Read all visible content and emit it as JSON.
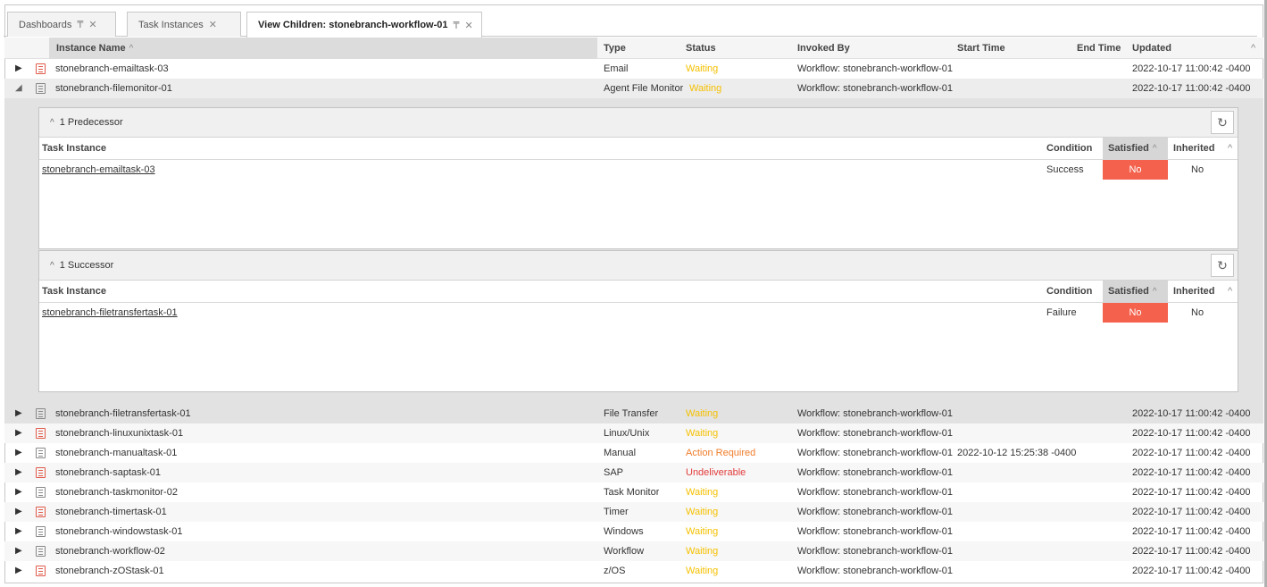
{
  "tabs": [
    {
      "label": "Dashboards",
      "pinned": true,
      "active": false
    },
    {
      "label": "Task Instances",
      "pinned": false,
      "active": false
    },
    {
      "label": "View Children: stonebranch-workflow-01",
      "pinned": true,
      "active": true
    }
  ],
  "grid": {
    "headers": {
      "name": "Instance Name",
      "type": "Type",
      "status": "Status",
      "invoked_by": "Invoked By",
      "start_time": "Start Time",
      "end_time": "End Time",
      "updated": "Updated"
    },
    "rows": [
      {
        "name": "stonebranch-emailtask-03",
        "type": "Email",
        "status": "Waiting",
        "invoked_by": "Workflow: stonebranch-workflow-01",
        "start_time": "",
        "end_time": "",
        "updated": "2022-10-17 11:00:42 -0400",
        "icon": "task-red"
      },
      {
        "name": "stonebranch-filemonitor-01",
        "type": "Agent File Monitor",
        "status": "Waiting",
        "invoked_by": "Workflow: stonebranch-workflow-01",
        "start_time": "",
        "end_time": "",
        "updated": "2022-10-17 11:00:42 -0400",
        "icon": "task-gray",
        "expanded": true
      },
      {
        "name": "stonebranch-filetransfertask-01",
        "type": "File Transfer",
        "status": "Waiting",
        "invoked_by": "Workflow: stonebranch-workflow-01",
        "start_time": "",
        "end_time": "",
        "updated": "2022-10-17 11:00:42 -0400",
        "icon": "task-gray"
      },
      {
        "name": "stonebranch-linuxunixtask-01",
        "type": "Linux/Unix",
        "status": "Waiting",
        "invoked_by": "Workflow: stonebranch-workflow-01",
        "start_time": "",
        "end_time": "",
        "updated": "2022-10-17 11:00:42 -0400",
        "icon": "task-red"
      },
      {
        "name": "stonebranch-manualtask-01",
        "type": "Manual",
        "status": "Action Required",
        "invoked_by": "Workflow: stonebranch-workflow-01",
        "start_time": "2022-10-12 15:25:38 -0400",
        "end_time": "",
        "updated": "2022-10-17 11:00:42 -0400",
        "icon": "task-gray"
      },
      {
        "name": "stonebranch-saptask-01",
        "type": "SAP",
        "status": "Undeliverable",
        "invoked_by": "Workflow: stonebranch-workflow-01",
        "start_time": "",
        "end_time": "",
        "updated": "2022-10-17 11:00:42 -0400",
        "icon": "task-red"
      },
      {
        "name": "stonebranch-taskmonitor-02",
        "type": "Task Monitor",
        "status": "Waiting",
        "invoked_by": "Workflow: stonebranch-workflow-01",
        "start_time": "",
        "end_time": "",
        "updated": "2022-10-17 11:00:42 -0400",
        "icon": "task-gray"
      },
      {
        "name": "stonebranch-timertask-01",
        "type": "Timer",
        "status": "Waiting",
        "invoked_by": "Workflow: stonebranch-workflow-01",
        "start_time": "",
        "end_time": "",
        "updated": "2022-10-17 11:00:42 -0400",
        "icon": "task-red"
      },
      {
        "name": "stonebranch-windowstask-01",
        "type": "Windows",
        "status": "Waiting",
        "invoked_by": "Workflow: stonebranch-workflow-01",
        "start_time": "",
        "end_time": "",
        "updated": "2022-10-17 11:00:42 -0400",
        "icon": "task-gray"
      },
      {
        "name": "stonebranch-workflow-02",
        "type": "Workflow",
        "status": "Waiting",
        "invoked_by": "Workflow: stonebranch-workflow-01",
        "start_time": "",
        "end_time": "",
        "updated": "2022-10-17 11:00:42 -0400",
        "icon": "task-gray"
      },
      {
        "name": "stonebranch-zOStask-01",
        "type": "z/OS",
        "status": "Waiting",
        "invoked_by": "Workflow: stonebranch-workflow-01",
        "start_time": "",
        "end_time": "",
        "updated": "2022-10-17 11:00:42 -0400",
        "icon": "task-red"
      }
    ]
  },
  "detail": {
    "predecessor": {
      "title": "1 Predecessor",
      "headers": {
        "task_instance": "Task Instance",
        "condition": "Condition",
        "satisfied": "Satisfied",
        "inherited": "Inherited"
      },
      "rows": [
        {
          "task_instance": "stonebranch-emailtask-03",
          "condition": "Success",
          "satisfied": "No",
          "inherited": "No"
        }
      ]
    },
    "successor": {
      "title": "1 Successor",
      "headers": {
        "task_instance": "Task Instance",
        "condition": "Condition",
        "satisfied": "Satisfied",
        "inherited": "Inherited"
      },
      "rows": [
        {
          "task_instance": "stonebranch-filetransfertask-01",
          "condition": "Failure",
          "satisfied": "No",
          "inherited": "No"
        }
      ]
    }
  },
  "colors": {
    "waiting": "#f5c000",
    "action_required": "#f07c2a",
    "undeliverable": "#e23b3b",
    "not_satisfied": "#f4614c",
    "active_tab_accent": "#4a90d9"
  },
  "icons": {
    "expand": "triangle-right-icon",
    "collapse": "triangle-down-icon",
    "task": "task-document-icon",
    "refresh": "refresh-icon",
    "sort": "caret-up-icon",
    "pin": "pin-icon",
    "close": "close-icon"
  }
}
